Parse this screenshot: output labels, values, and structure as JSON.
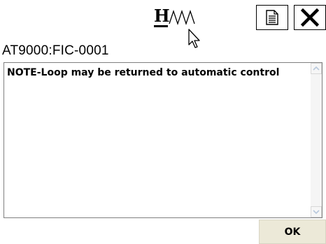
{
  "header": {
    "logo_text": "H",
    "tag_title": "AT9000:FIC-0001"
  },
  "toolbar": {
    "doc_icon": "document-icon",
    "close_icon": "close-icon"
  },
  "note": {
    "text": "NOTE-Loop may be returned to automatic control"
  },
  "footer": {
    "ok_label": "OK"
  },
  "colors": {
    "button_face": "#ece9d8",
    "scroll_arrow": "#b8c8dc"
  }
}
